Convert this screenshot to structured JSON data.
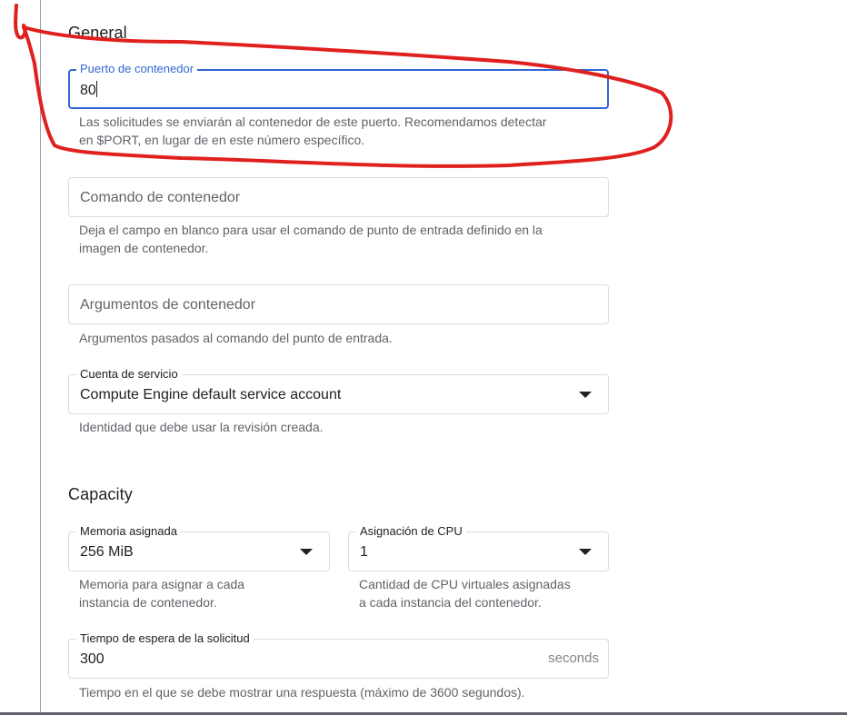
{
  "sections": {
    "general_title": "General",
    "capacity_title": "Capacity"
  },
  "port": {
    "label": "Puerto de contenedor",
    "value": "80",
    "hint_line1": "Las solicitudes se enviarán al contenedor de este puerto. Recomendamos detectar",
    "hint_line2": "en $PORT, en lugar de en este número específico."
  },
  "command": {
    "placeholder": "Comando de contenedor",
    "hint_line1": "Deja el campo en blanco para usar el comando de punto de entrada definido en la",
    "hint_line2": "imagen de contenedor."
  },
  "arguments": {
    "placeholder": "Argumentos de contenedor",
    "hint": "Argumentos pasados al comando del punto de entrada."
  },
  "service_account": {
    "label": "Cuenta de servicio",
    "value": "Compute Engine default service account",
    "hint": "Identidad que debe usar la revisión creada."
  },
  "memory": {
    "label": "Memoria asignada",
    "value": "256 MiB",
    "hint_line1": "Memoria para asignar a cada",
    "hint_line2": "instancia de contenedor."
  },
  "cpu": {
    "label": "Asignación de CPU",
    "value": "1",
    "hint_line1": "Cantidad de CPU virtuales asignadas",
    "hint_line2": "a cada instancia del contenedor."
  },
  "timeout": {
    "label": "Tiempo de espera de la solicitud",
    "value": "300",
    "suffix": "seconds",
    "hint": "Tiempo en el que se debe mostrar una respuesta (máximo de 3600 segundos)."
  },
  "colors": {
    "focus": "#3367d6",
    "annotation": "#e0201e"
  },
  "icons": {
    "dropdown": "dropdown-caret-icon"
  }
}
